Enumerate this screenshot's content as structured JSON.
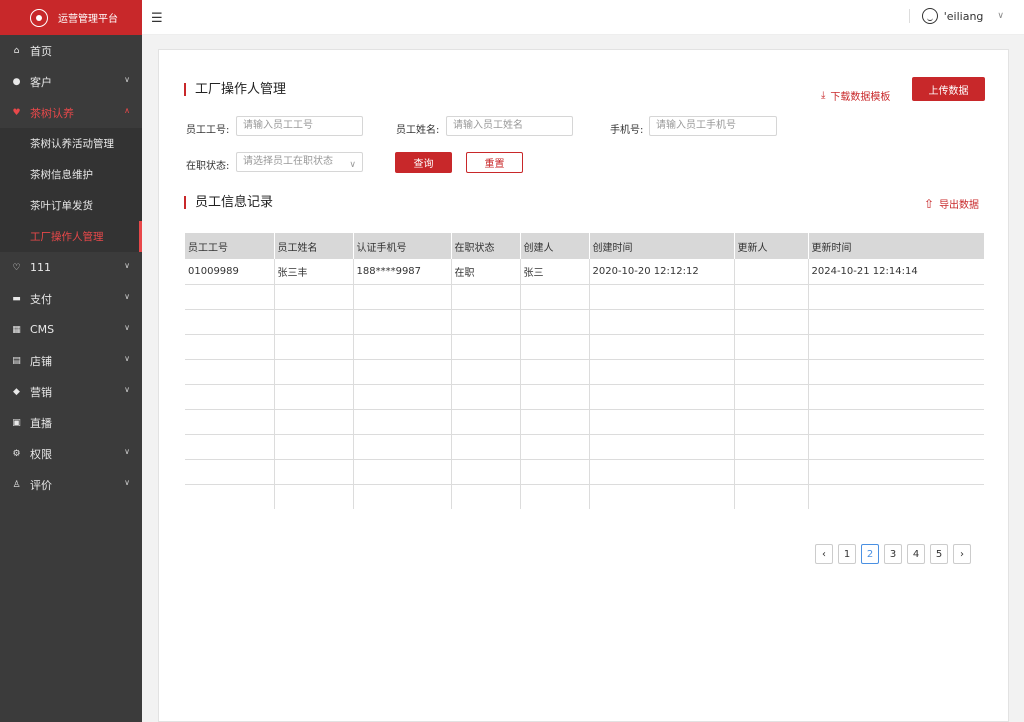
{
  "brand": {
    "title": "运营管理平台"
  },
  "header": {
    "username": "'eiliang"
  },
  "sidebar": {
    "items": [
      {
        "label": "首页",
        "icon": "home-icon",
        "glyph": "⌂",
        "has_children": false
      },
      {
        "label": "客户",
        "icon": "user-icon",
        "glyph": "●",
        "has_children": true
      },
      {
        "label": "茶树认养",
        "icon": "tea-icon",
        "glyph": "♥",
        "has_children": true,
        "open": true
      },
      {
        "label": "111",
        "icon": "heart-icon",
        "glyph": "♡",
        "has_children": true
      },
      {
        "label": "支付",
        "icon": "card-icon",
        "glyph": "▬",
        "has_children": true
      },
      {
        "label": "CMS",
        "icon": "grid-icon",
        "glyph": "▦",
        "has_children": true
      },
      {
        "label": "店铺",
        "icon": "shop-icon",
        "glyph": "▤",
        "has_children": true
      },
      {
        "label": "营销",
        "icon": "tag-icon",
        "glyph": "◆",
        "has_children": true
      },
      {
        "label": "直播",
        "icon": "live-icon",
        "glyph": "▣",
        "has_children": false
      },
      {
        "label": "权限",
        "icon": "lock-icon",
        "glyph": "⚙",
        "has_children": true
      },
      {
        "label": "评价",
        "icon": "person-icon",
        "glyph": "♙",
        "has_children": true
      }
    ],
    "subitems": [
      {
        "label": "茶树认养活动管理"
      },
      {
        "label": "茶树信息维护"
      },
      {
        "label": "茶叶订单发货"
      },
      {
        "label": "工厂操作人管理",
        "active": true
      }
    ]
  },
  "page": {
    "title": "工厂操作人管理",
    "download_template": "下载数据模板",
    "upload_button": "上传数据",
    "filters": {
      "employee_id_label": "员工工号:",
      "employee_id_placeholder": "请输入员工工号",
      "employee_name_label": "员工姓名:",
      "employee_name_placeholder": "请输入员工姓名",
      "phone_label": "手机号:",
      "phone_placeholder": "请输入员工手机号",
      "status_label": "在职状态:",
      "status_placeholder": "请选择员工在职状态",
      "query_button": "查询",
      "reset_button": "重置"
    },
    "records_title": "员工信息记录",
    "export_link": "导出数据"
  },
  "table": {
    "columns": [
      "员工工号",
      "员工姓名",
      "认证手机号",
      "在职状态",
      "创建人",
      "创建时间",
      "更新人",
      "更新时间"
    ],
    "rows": [
      [
        "01009989",
        "张三丰",
        "188****9987",
        "在职",
        "张三",
        "2020-10-20 12:12:12",
        "",
        "2024-10-21 12:14:14"
      ],
      [
        "",
        "",
        "",
        "",
        "",
        "",
        "",
        ""
      ],
      [
        "",
        "",
        "",
        "",
        "",
        "",
        "",
        ""
      ],
      [
        "",
        "",
        "",
        "",
        "",
        "",
        "",
        ""
      ],
      [
        "",
        "",
        "",
        "",
        "",
        "",
        "",
        ""
      ],
      [
        "",
        "",
        "",
        "",
        "",
        "",
        "",
        ""
      ],
      [
        "",
        "",
        "",
        "",
        "",
        "",
        "",
        ""
      ],
      [
        "",
        "",
        "",
        "",
        "",
        "",
        "",
        ""
      ],
      [
        "",
        "",
        "",
        "",
        "",
        "",
        "",
        ""
      ],
      [
        "",
        "",
        "",
        "",
        "",
        "",
        "",
        ""
      ]
    ]
  },
  "pagination": {
    "pages": [
      "1",
      "2",
      "3",
      "4",
      "5"
    ],
    "current": "2",
    "prev": "‹",
    "next": "›"
  },
  "colors": {
    "accent": "#c8282a",
    "sidebar_bg": "#3b3b3b",
    "active_page": "#4a90e2"
  }
}
